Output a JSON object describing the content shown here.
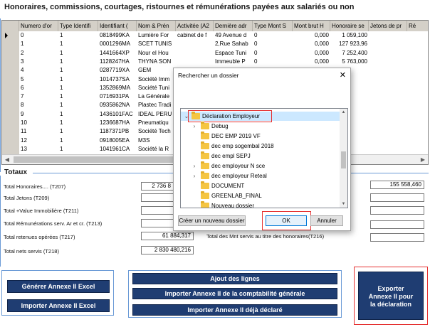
{
  "section_title": "Honoraires, commissions, courtages, ristournes et rémunérations payées aux salariés ou non",
  "grid": {
    "columns": [
      "Numero d'or",
      "Type Identifi",
      "Identifiant (",
      "Nom & Prén",
      "Activitée (A2",
      "Dernière adr",
      "Type Mont S",
      "Mont brut H",
      "Honoraire se",
      "Jetons de pr",
      "Ré"
    ],
    "rows": [
      [
        "0",
        "1",
        "0818499KA",
        "Lumière For",
        "cabinet de f",
        "49 Avenue d",
        "0",
        "0,000",
        "1 059,100",
        "",
        ""
      ],
      [
        "1",
        "1",
        "0001296MA",
        "SCET TUNIS",
        "",
        "2,Rue Sahab",
        "0",
        "0,000",
        "127 923,96",
        "",
        ""
      ],
      [
        "2",
        "1",
        "1441664XP",
        "Nour el Hou",
        "",
        "Espace Tuni",
        "0",
        "0,000",
        "7 252,400",
        "",
        ""
      ],
      [
        "3",
        "1",
        "1128247HA",
        "THYNA SON",
        "",
        "Immeuble P",
        "0",
        "0,000",
        "5 763,000",
        "",
        ""
      ],
      [
        "4",
        "1",
        "0287719XA",
        "GEM",
        "",
        "",
        "",
        "",
        "",
        "",
        ""
      ],
      [
        "5",
        "1",
        "1014737SA",
        "Société Imm",
        "",
        "",
        "",
        "",
        "",
        "",
        ""
      ],
      [
        "6",
        "1",
        "1352869MA",
        "Société Tuni",
        "",
        "",
        "",
        "",
        "",
        "",
        ""
      ],
      [
        "7",
        "1",
        "0716931PA",
        "La Générale",
        "",
        "",
        "",
        "",
        "",
        "",
        ""
      ],
      [
        "8",
        "1",
        "0935862NA",
        "Plastec Tradi",
        "",
        "",
        "",
        "",
        "",
        "",
        ""
      ],
      [
        "9",
        "1",
        "1436101FAC",
        "IDEAL PERU",
        "",
        "",
        "",
        "",
        "",
        "",
        ""
      ],
      [
        "10",
        "1",
        "1236687HA",
        "Pneumatiqu",
        "",
        "",
        "",
        "",
        "",
        "",
        ""
      ],
      [
        "11",
        "1",
        "1187371PB",
        "Société Tech",
        "",
        "",
        "",
        "",
        "",
        "",
        ""
      ],
      [
        "12",
        "1",
        "0918005EA",
        "M3S",
        "",
        "",
        "",
        "",
        "",
        "",
        ""
      ],
      [
        "13",
        "1",
        "1041961CA",
        "Société la R",
        "",
        "",
        "",
        "",
        "",
        "",
        ""
      ]
    ]
  },
  "totaux": {
    "title": "Totaux",
    "labels": {
      "honoraires": "Total Honoraires.... (T207)",
      "jetons": "Total Jetons (T209)",
      "value_immo": "Total +Value Immobilière (T211)",
      "remunerations": "Total Rémunérations serv. Ar et cr. (T213)",
      "retenues": "Total retenues opérées (T217)",
      "nets": "Total nets servis (T218)",
      "mnt_servis": "Total des Mnt servis au titre des honoraires(T216)"
    },
    "values": {
      "honoraires": "2 736 8",
      "jetons": "",
      "value_immo": "",
      "remunerations": "",
      "retenues": "61 884,317",
      "nets": "2 830 480,216",
      "right_top": "155 558,460"
    }
  },
  "buttons": {
    "generer": "Générer Annexe II Excel",
    "importer_excel": "Importer Annexe II Excel",
    "ajout": "Ajout des lignes",
    "importer_compta": "Importer Annexe II  de la comptabilité générale",
    "importer_declare": "Importer Annexe II déjà déclaré",
    "exporter": "Exporter\nAnnexe II  pour\nla déclaration"
  },
  "dialog": {
    "title": "Rechercher un dossier",
    "close": "✕",
    "selected": "Déclaration Employeur",
    "items": [
      {
        "label": "Debug",
        "expandable": true
      },
      {
        "label": "DEC EMP 2019 VF",
        "expandable": false
      },
      {
        "label": "dec emp sogembal 2018",
        "expandable": false
      },
      {
        "label": "dec empl SEPJ",
        "expandable": false
      },
      {
        "label": "dec employeur N sce",
        "expandable": true
      },
      {
        "label": "dec employeur Reteal",
        "expandable": true
      },
      {
        "label": "DOCUMENT",
        "expandable": false
      },
      {
        "label": "GREENLAB_FINAL",
        "expandable": false
      },
      {
        "label": "Nouveau dossier",
        "expandable": false
      }
    ],
    "new_folder": "Créer un nouveau dossier",
    "ok": "OK",
    "cancel": "Annuler"
  },
  "colors": {
    "navy_button": "#1f3d72",
    "frame_blue": "#6a9ad6",
    "highlight_red": "#e53030",
    "selected_folder_bg": "#cce8ff"
  }
}
